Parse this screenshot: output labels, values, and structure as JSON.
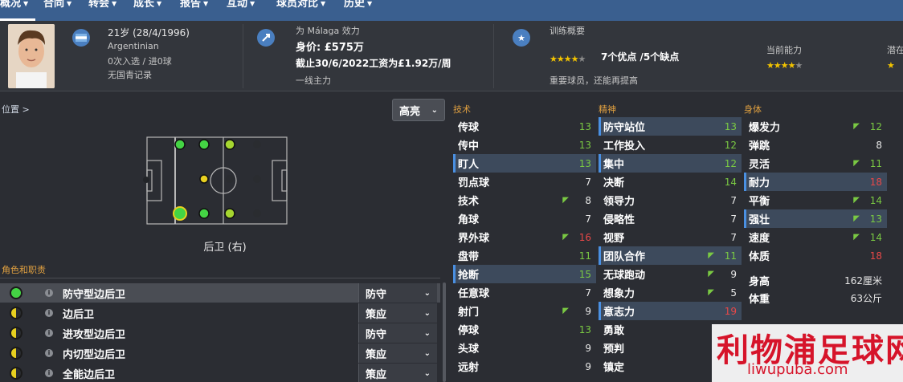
{
  "nav": {
    "items": [
      {
        "label": "概况",
        "active": true
      },
      {
        "label": "合同",
        "active": false
      },
      {
        "label": "转会",
        "active": false
      },
      {
        "label": "成长",
        "active": false
      },
      {
        "label": "报告",
        "active": false
      },
      {
        "label": "互动",
        "active": false
      },
      {
        "label": "球员对比",
        "active": false
      },
      {
        "label": "历史",
        "active": false
      }
    ]
  },
  "info": {
    "age": "21岁 (28/4/1996)",
    "nationality": "Argentinian",
    "caps": "0次入选 / 进0球",
    "youth": "无国青记录",
    "club_line": "为 Málaga 效力",
    "value": "身价: £575万",
    "contract": "截止30/6/2022工资为£1.92万/周",
    "squad_status": "一线主力",
    "training_title": "训练概要",
    "training_stars_text": "7个优点 /5个缺点",
    "training_note": "重要球员，还能再提高",
    "current_ability_label": "当前能力",
    "potential_label": "潜在",
    "training_stars": 4,
    "current_ability_stars": 4
  },
  "left": {
    "position_link": "位置 >",
    "dropdown_value": "高亮",
    "position_label": "后卫 (右)",
    "roles_title": "角色和职责",
    "roles": [
      {
        "name": "防守型边后卫",
        "duty": "防守",
        "dot": "green",
        "selected": true
      },
      {
        "name": "边后卫",
        "duty": "策应",
        "dot": "half",
        "selected": false
      },
      {
        "name": "进攻型边后卫",
        "duty": "防守",
        "dot": "half",
        "selected": false
      },
      {
        "name": "内切型边后卫",
        "duty": "策应",
        "dot": "half",
        "selected": false
      },
      {
        "name": "全能边后卫",
        "duty": "策应",
        "dot": "half",
        "selected": false
      }
    ]
  },
  "technical": {
    "title": "技术",
    "rows": [
      {
        "name": "传球",
        "value": "13",
        "color": "green",
        "hl": false,
        "arrow": false
      },
      {
        "name": "传中",
        "value": "13",
        "color": "green",
        "hl": false,
        "arrow": false
      },
      {
        "name": "盯人",
        "value": "13",
        "color": "green",
        "hl": true,
        "arrow": false
      },
      {
        "name": "罚点球",
        "value": "7",
        "color": "white",
        "hl": false,
        "arrow": false
      },
      {
        "name": "技术",
        "value": "8",
        "color": "white",
        "hl": false,
        "arrow": true
      },
      {
        "name": "角球",
        "value": "7",
        "color": "white",
        "hl": false,
        "arrow": false
      },
      {
        "name": "界外球",
        "value": "16",
        "color": "red",
        "hl": false,
        "arrow": true
      },
      {
        "name": "盘带",
        "value": "11",
        "color": "green",
        "hl": false,
        "arrow": false
      },
      {
        "name": "抢断",
        "value": "15",
        "color": "green",
        "hl": true,
        "arrow": false
      },
      {
        "name": "任意球",
        "value": "7",
        "color": "white",
        "hl": false,
        "arrow": false
      },
      {
        "name": "射门",
        "value": "9",
        "color": "white",
        "hl": false,
        "arrow": true
      },
      {
        "name": "停球",
        "value": "13",
        "color": "green",
        "hl": false,
        "arrow": false
      },
      {
        "name": "头球",
        "value": "9",
        "color": "white",
        "hl": false,
        "arrow": false
      },
      {
        "name": "远射",
        "value": "9",
        "color": "white",
        "hl": false,
        "arrow": false
      }
    ]
  },
  "mental": {
    "title": "精神",
    "rows": [
      {
        "name": "防守站位",
        "value": "13",
        "color": "green",
        "hl": true,
        "arrow": false
      },
      {
        "name": "工作投入",
        "value": "12",
        "color": "green",
        "hl": false,
        "arrow": false
      },
      {
        "name": "集中",
        "value": "12",
        "color": "green",
        "hl": true,
        "arrow": false
      },
      {
        "name": "决断",
        "value": "14",
        "color": "green",
        "hl": false,
        "arrow": false
      },
      {
        "name": "领导力",
        "value": "7",
        "color": "white",
        "hl": false,
        "arrow": false
      },
      {
        "name": "侵略性",
        "value": "7",
        "color": "white",
        "hl": false,
        "arrow": false
      },
      {
        "name": "视野",
        "value": "7",
        "color": "white",
        "hl": false,
        "arrow": false
      },
      {
        "name": "团队合作",
        "value": "11",
        "color": "green",
        "hl": true,
        "arrow": true
      },
      {
        "name": "无球跑动",
        "value": "9",
        "color": "white",
        "hl": false,
        "arrow": true
      },
      {
        "name": "想象力",
        "value": "5",
        "color": "white",
        "hl": false,
        "arrow": true
      },
      {
        "name": "意志力",
        "value": "19",
        "color": "red",
        "hl": true,
        "arrow": false
      },
      {
        "name": "勇敢",
        "value": "",
        "color": "white",
        "hl": false,
        "arrow": false
      },
      {
        "name": "预判",
        "value": "",
        "color": "white",
        "hl": false,
        "arrow": false
      },
      {
        "name": "镇定",
        "value": "",
        "color": "white",
        "hl": false,
        "arrow": false
      }
    ]
  },
  "physical": {
    "title": "身体",
    "rows": [
      {
        "name": "爆发力",
        "value": "12",
        "color": "green",
        "hl": false,
        "arrow": true
      },
      {
        "name": "弹跳",
        "value": "8",
        "color": "white",
        "hl": false,
        "arrow": false
      },
      {
        "name": "灵活",
        "value": "11",
        "color": "green",
        "hl": false,
        "arrow": true
      },
      {
        "name": "耐力",
        "value": "18",
        "color": "red",
        "hl": true,
        "arrow": false
      },
      {
        "name": "平衡",
        "value": "14",
        "color": "green",
        "hl": false,
        "arrow": true
      },
      {
        "name": "强壮",
        "value": "13",
        "color": "green",
        "hl": true,
        "arrow": true
      },
      {
        "name": "速度",
        "value": "14",
        "color": "green",
        "hl": false,
        "arrow": true
      },
      {
        "name": "体质",
        "value": "18",
        "color": "red",
        "hl": false,
        "arrow": false
      }
    ],
    "height_label": "身高",
    "height_value": "162厘米",
    "weight_label": "体重",
    "weight_value": "63公斤"
  },
  "watermark": {
    "cn": "利物浦足球网",
    "url": "liwupuba.com"
  }
}
